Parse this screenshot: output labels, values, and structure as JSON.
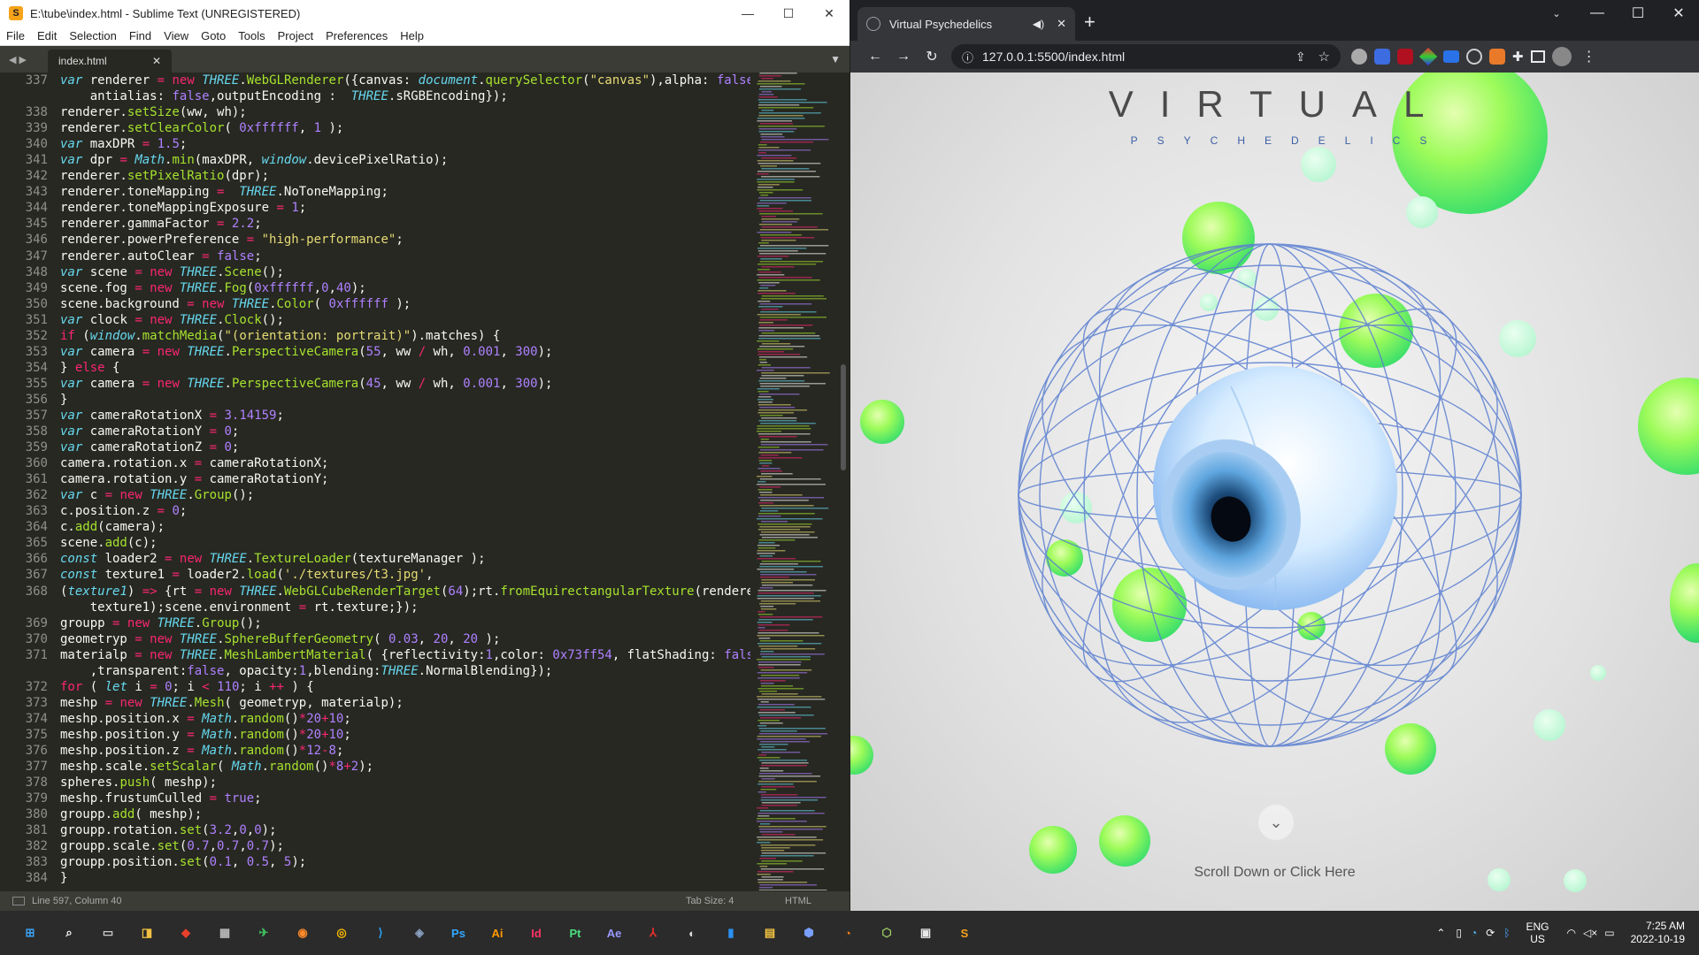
{
  "sublime": {
    "title": "E:\\tube\\index.html - Sublime Text (UNREGISTERED)",
    "menu": [
      "File",
      "Edit",
      "Selection",
      "Find",
      "View",
      "Goto",
      "Tools",
      "Project",
      "Preferences",
      "Help"
    ],
    "tab_name": "index.html",
    "status_left": "Line 597, Column 40",
    "status_tab_size": "Tab Size: 4",
    "status_syntax": "HTML",
    "line_numbers": [
      "337",
      "",
      "338",
      "339",
      "340",
      "341",
      "342",
      "343",
      "344",
      "345",
      "346",
      "347",
      "348",
      "349",
      "350",
      "351",
      "352",
      "353",
      "354",
      "355",
      "356",
      "357",
      "358",
      "359",
      "360",
      "361",
      "362",
      "363",
      "364",
      "365",
      "366",
      "367",
      "368",
      "",
      "369",
      "370",
      "371",
      "",
      "372",
      "373",
      "374",
      "375",
      "376",
      "377",
      "378",
      "379",
      "380",
      "381",
      "382",
      "383",
      "384"
    ]
  },
  "chrome": {
    "tab_title": "Virtual Psychedelics",
    "url": "127.0.0.1:5500/index.html",
    "page": {
      "title": "VIRTUAL",
      "subtitle": "PSYCHEDELICS",
      "scroll_label": "Scroll Down or Click Here"
    }
  },
  "taskbar": {
    "apps": [
      {
        "name": "start",
        "label": "⊞",
        "color": "#3aa0f0"
      },
      {
        "name": "search",
        "label": "⌕",
        "color": "#ffffff"
      },
      {
        "name": "task-view",
        "label": "▭",
        "color": "#cccccc"
      },
      {
        "name": "store",
        "label": "◨",
        "color": "#f0c040"
      },
      {
        "name": "app-red",
        "label": "◆",
        "color": "#e8402a"
      },
      {
        "name": "calculator",
        "label": "▦",
        "color": "#bbbbbb"
      },
      {
        "name": "telegram",
        "label": "✈",
        "color": "#40c060"
      },
      {
        "name": "firefox",
        "label": "◉",
        "color": "#ff8a2a"
      },
      {
        "name": "chrome",
        "label": "◎",
        "color": "#fbbc05"
      },
      {
        "name": "vscode",
        "label": "⟩",
        "color": "#2aa0f0"
      },
      {
        "name": "davinci",
        "label": "◈",
        "color": "#8aa0c0"
      },
      {
        "name": "photoshop",
        "label": "Ps",
        "color": "#31a8ff"
      },
      {
        "name": "illustrator",
        "label": "Ai",
        "color": "#ff9a00"
      },
      {
        "name": "indesign",
        "label": "Id",
        "color": "#ff3366"
      },
      {
        "name": "prelude",
        "label": "Pt",
        "color": "#4ade80"
      },
      {
        "name": "after-effects",
        "label": "Ae",
        "color": "#9999ff"
      },
      {
        "name": "acrobat",
        "label": "⅄",
        "color": "#e8302a"
      },
      {
        "name": "obs",
        "label": "◐",
        "color": "#dddddd"
      },
      {
        "name": "app-blue",
        "label": "▮",
        "color": "#2a90f0"
      },
      {
        "name": "file-explorer",
        "label": "▤",
        "color": "#f5c542"
      },
      {
        "name": "app-shield",
        "label": "⬢",
        "color": "#7aa0ff"
      },
      {
        "name": "blender",
        "label": "◔",
        "color": "#f57f17"
      },
      {
        "name": "app-green",
        "label": "⬡",
        "color": "#9ccc65"
      },
      {
        "name": "app-active",
        "label": "▣",
        "color": "#e8e8e8"
      },
      {
        "name": "sublime",
        "label": "S",
        "color": "#f6a21a"
      }
    ],
    "lang": "ENG",
    "region": "US",
    "time": "7:25 AM",
    "date": "2022-10-19"
  }
}
